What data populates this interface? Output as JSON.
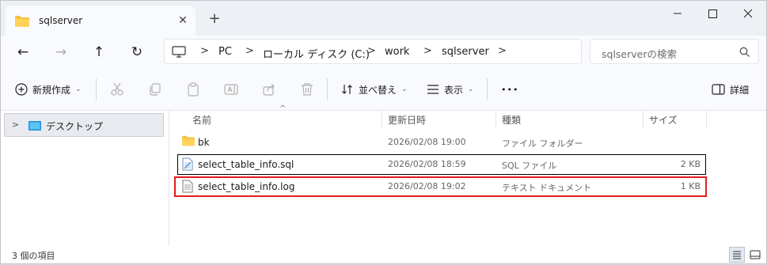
{
  "tab": {
    "title": "sqlserver",
    "close": "✕",
    "new": "+"
  },
  "nav": {
    "back": "←",
    "forward": "→",
    "up": "↑",
    "refresh": "↻"
  },
  "breadcrumb": {
    "sep": ">",
    "items": [
      "PC",
      "ローカル ディスク (C:)",
      "work",
      "sqlserver"
    ]
  },
  "search": {
    "placeholder": "sqlserverの検索"
  },
  "toolbar": {
    "new_label": "新規作成",
    "sort_label": "並べ替え",
    "view_label": "表示",
    "more_label": "•••",
    "details_label": "詳細",
    "chevron": "⌄"
  },
  "sidebar": {
    "items": [
      {
        "label": "デスクトップ",
        "arrow": ">"
      }
    ]
  },
  "columns": {
    "name": "名前",
    "date": "更新日時",
    "type": "種類",
    "size": "サイズ"
  },
  "files": [
    {
      "name": "bk",
      "date": "2026/02/08 19:00",
      "type": "ファイル フォルダー",
      "size": ""
    },
    {
      "name": "select_table_info.sql",
      "date": "2026/02/08 18:59",
      "type": "SQL ファイル",
      "size": "2 KB"
    },
    {
      "name": "select_table_info.log",
      "date": "2026/02/08 19:02",
      "type": "テキスト ドキュメント",
      "size": "1 KB"
    }
  ],
  "status": {
    "count": "3 個の項目"
  },
  "colors": {
    "accent": "#0067c0",
    "highlight": "#e11c1c",
    "folder": "#f4c042"
  }
}
